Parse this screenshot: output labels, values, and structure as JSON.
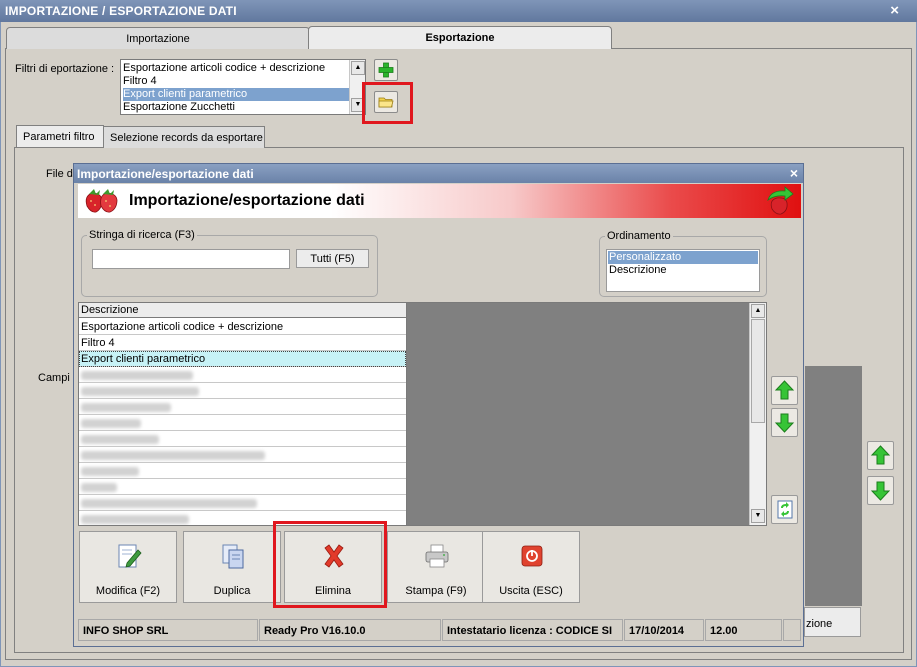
{
  "main_window": {
    "title": "IMPORTAZIONE / ESPORTAZIONE DATI",
    "close_label": "×",
    "tabs": [
      {
        "label": "Importazione"
      },
      {
        "label": "Esportazione"
      }
    ],
    "filters_label": "Filtri di eportazione :",
    "filters_list": [
      "Esportazione articoli codice + descrizione",
      "Filtro 4",
      "Export clienti parametrico",
      "Esportazione Zucchetti"
    ],
    "subtabs": [
      {
        "label": "Parametri filtro"
      },
      {
        "label": "Selezione records da esportare"
      }
    ],
    "file_label_partial": "File d",
    "campi_label_partial": "Campi :",
    "zione_button_partial": "zione"
  },
  "dialog": {
    "title": "Importazione/esportazione dati",
    "close_label": "×",
    "banner_title": "Importazione/esportazione dati",
    "search": {
      "legend": "Stringa di ricerca (F3)",
      "value": "",
      "button_label": "Tutti (F5)"
    },
    "ordering": {
      "legend": "Ordinamento",
      "options": [
        "Personalizzato",
        "Descrizione"
      ]
    },
    "grid": {
      "header": "Descrizione",
      "rows": [
        "Esportazione articoli codice + descrizione",
        "Filtro 4",
        "Export clienti parametrico"
      ]
    },
    "actions": [
      {
        "label": "Modifica (F2)"
      },
      {
        "label": "Duplica"
      },
      {
        "label": "Elimina"
      },
      {
        "label": "Stampa (F9)"
      },
      {
        "label": "Uscita (ESC)"
      }
    ],
    "status": {
      "company": "INFO SHOP SRL",
      "version": "Ready Pro V16.10.0",
      "license": "Intestatario licenza : CODICE SI",
      "date": "17/10/2014",
      "time": "12.00"
    }
  },
  "colors": {
    "titlebar": "#61789e",
    "selection": "#7da2ce",
    "highlight_frame": "#e0171e",
    "grid_selected_row": "#c7f2f6",
    "arrow_green": "#2bb52b"
  }
}
